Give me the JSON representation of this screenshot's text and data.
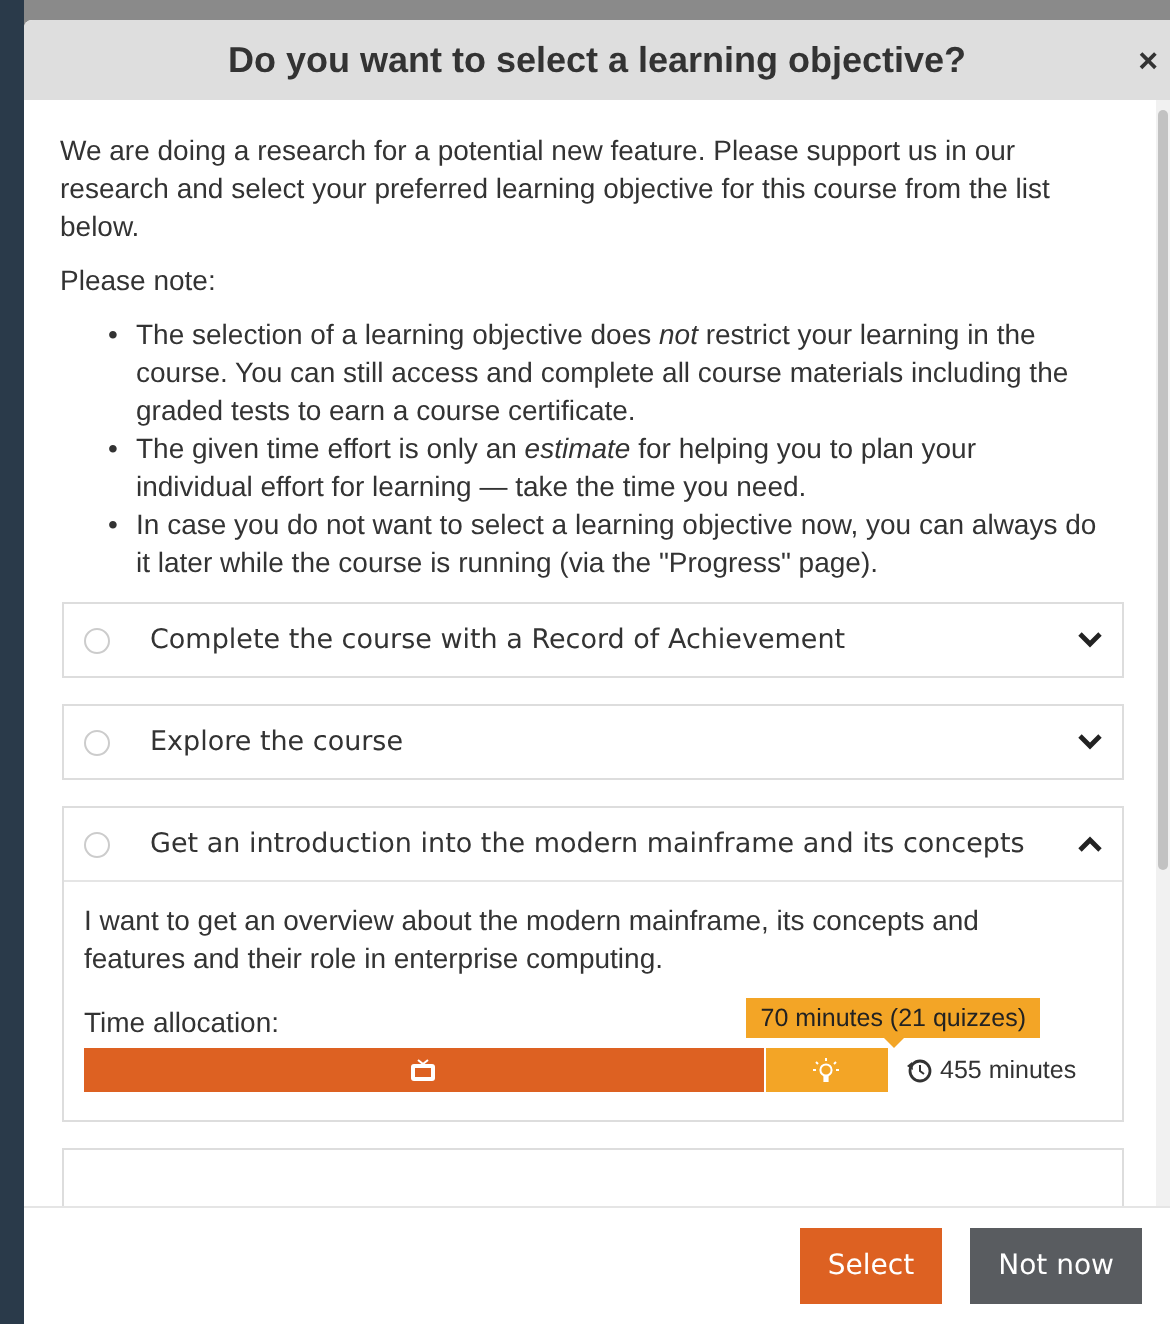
{
  "dialog": {
    "title": "Do you want to select a learning objective?",
    "close": "×"
  },
  "intro": "We are doing a research for a potential new feature. Please support us in our research and select your preferred learning objective for this course from the list below.",
  "note_heading": "Please note:",
  "notes": [
    {
      "bullet": "•",
      "text": "The selection of a learning objective does *not* restrict your learning in the course. You can still access and complete all course materials including the graded tests to earn a course certificate."
    },
    {
      "bullet": "•",
      "text": "The given time effort is only an *estimate* for helping you to plan your individual effort for learning — take the time you need."
    },
    {
      "bullet": "•",
      "text": "In case you do not want to select a learning objective now, you can always do it later while the course is running (via the \"Progress\" page)."
    }
  ],
  "objectives": [
    {
      "title": "Complete the course with a Record of Achievement",
      "selected": false,
      "expanded": false
    },
    {
      "title": "Explore the course",
      "selected": false,
      "expanded": false
    },
    {
      "title": "Get an introduction into the modern mainframe and its concepts",
      "selected": false,
      "expanded": true,
      "description": "I want to get an overview about the modern mainframe, its concepts and features and their role in enterprise computing.",
      "time_label": "Time allocation:",
      "segments": [
        {
          "kind": "video",
          "level": 0.846
        },
        {
          "kind": "quiz",
          "level": 0.154,
          "tooltip": "70 minutes (21 quizzes)"
        }
      ],
      "total": "455 minutes"
    }
  ],
  "buttons": [
    {
      "label": "Select",
      "kind": "primary"
    },
    {
      "label": "Not now",
      "kind": "secondary"
    }
  ]
}
